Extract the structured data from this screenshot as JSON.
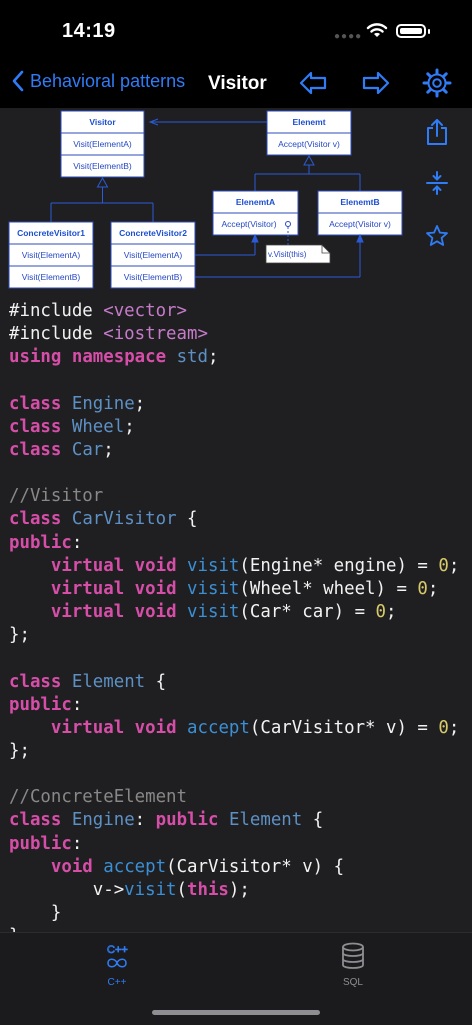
{
  "status": {
    "time": "14:19"
  },
  "nav": {
    "back_label": "Behavioral patterns",
    "title": "Visitor"
  },
  "diagram": {
    "visitor": {
      "title": "Visitor",
      "methods": [
        "Visit(ElementA)",
        "Visit(ElementB)"
      ]
    },
    "element": {
      "title": "Elenemt",
      "methods": [
        "Accept(Visitor v)"
      ]
    },
    "concrete_visitor_1": {
      "title": "ConcreteVisitor1",
      "methods": [
        "Visit(ElementA)",
        "Visit(ElementB)"
      ]
    },
    "concrete_visitor_2": {
      "title": "ConcreteVisitor2",
      "methods": [
        "Visit(ElementA)",
        "Visit(ElementB)"
      ]
    },
    "element_a": {
      "title": "ElenemtA",
      "methods": [
        "Accept(Visitor)"
      ]
    },
    "element_b": {
      "title": "ElenemtB",
      "methods": [
        "Accept(Visitor v)"
      ]
    },
    "note": "v.Visit(this)",
    "colors": {
      "line": "#2b5bd6",
      "box_border": "#2c4db8",
      "title_text": "#1b4fd0",
      "method_text": "#2548c4"
    }
  },
  "code": {
    "lines": [
      [
        [
          "plain",
          "#include "
        ],
        [
          "inc",
          "<vector>"
        ]
      ],
      [
        [
          "plain",
          "#include "
        ],
        [
          "inc",
          "<iostream>"
        ]
      ],
      [
        [
          "kw",
          "using"
        ],
        [
          "plain",
          " "
        ],
        [
          "kw",
          "namespace"
        ],
        [
          "plain",
          " "
        ],
        [
          "ty",
          "std"
        ],
        [
          "plain",
          ";"
        ]
      ],
      [],
      [
        [
          "kw",
          "class"
        ],
        [
          "plain",
          " "
        ],
        [
          "ty",
          "Engine"
        ],
        [
          "plain",
          ";"
        ]
      ],
      [
        [
          "kw",
          "class"
        ],
        [
          "plain",
          " "
        ],
        [
          "ty",
          "Wheel"
        ],
        [
          "plain",
          ";"
        ]
      ],
      [
        [
          "kw",
          "class"
        ],
        [
          "plain",
          " "
        ],
        [
          "ty",
          "Car"
        ],
        [
          "plain",
          ";"
        ]
      ],
      [],
      [
        [
          "cm",
          "//Visitor"
        ]
      ],
      [
        [
          "kw",
          "class"
        ],
        [
          "plain",
          " "
        ],
        [
          "ty",
          "CarVisitor"
        ],
        [
          "plain",
          " {"
        ]
      ],
      [
        [
          "kw",
          "public"
        ],
        [
          "plain",
          ":"
        ]
      ],
      [
        [
          "plain",
          "    "
        ],
        [
          "kw",
          "virtual"
        ],
        [
          "plain",
          " "
        ],
        [
          "kw",
          "void"
        ],
        [
          "plain",
          " "
        ],
        [
          "fn",
          "visit"
        ],
        [
          "plain",
          "(Engine* engine) = "
        ],
        [
          "num",
          "0"
        ],
        [
          "plain",
          ";"
        ]
      ],
      [
        [
          "plain",
          "    "
        ],
        [
          "kw",
          "virtual"
        ],
        [
          "plain",
          " "
        ],
        [
          "kw",
          "void"
        ],
        [
          "plain",
          " "
        ],
        [
          "fn",
          "visit"
        ],
        [
          "plain",
          "(Wheel* wheel) = "
        ],
        [
          "num",
          "0"
        ],
        [
          "plain",
          ";"
        ]
      ],
      [
        [
          "plain",
          "    "
        ],
        [
          "kw",
          "virtual"
        ],
        [
          "plain",
          " "
        ],
        [
          "kw",
          "void"
        ],
        [
          "plain",
          " "
        ],
        [
          "fn",
          "visit"
        ],
        [
          "plain",
          "(Car* car) = "
        ],
        [
          "num",
          "0"
        ],
        [
          "plain",
          ";"
        ]
      ],
      [
        [
          "plain",
          "};"
        ]
      ],
      [],
      [
        [
          "kw",
          "class"
        ],
        [
          "plain",
          " "
        ],
        [
          "ty",
          "Element"
        ],
        [
          "plain",
          " {"
        ]
      ],
      [
        [
          "kw",
          "public"
        ],
        [
          "plain",
          ":"
        ]
      ],
      [
        [
          "plain",
          "    "
        ],
        [
          "kw",
          "virtual"
        ],
        [
          "plain",
          " "
        ],
        [
          "kw",
          "void"
        ],
        [
          "plain",
          " "
        ],
        [
          "fn",
          "accept"
        ],
        [
          "plain",
          "(CarVisitor* v) = "
        ],
        [
          "num",
          "0"
        ],
        [
          "plain",
          ";"
        ]
      ],
      [
        [
          "plain",
          "};"
        ]
      ],
      [],
      [
        [
          "cm",
          "//ConcreteElement"
        ]
      ],
      [
        [
          "kw",
          "class"
        ],
        [
          "plain",
          " "
        ],
        [
          "ty",
          "Engine"
        ],
        [
          "plain",
          ": "
        ],
        [
          "kw",
          "public"
        ],
        [
          "plain",
          " "
        ],
        [
          "ty",
          "Element"
        ],
        [
          "plain",
          " {"
        ]
      ],
      [
        [
          "kw",
          "public"
        ],
        [
          "plain",
          ":"
        ]
      ],
      [
        [
          "plain",
          "    "
        ],
        [
          "kw",
          "void"
        ],
        [
          "plain",
          " "
        ],
        [
          "fn",
          "accept"
        ],
        [
          "plain",
          "(CarVisitor* v) {"
        ]
      ],
      [
        [
          "plain",
          "        v->"
        ],
        [
          "fn",
          "visit"
        ],
        [
          "plain",
          "("
        ],
        [
          "kw",
          "this"
        ],
        [
          "plain",
          ");"
        ]
      ],
      [
        [
          "plain",
          "    }"
        ]
      ],
      [
        [
          "plain",
          "}"
        ]
      ]
    ]
  },
  "tabs": [
    {
      "label": "C++",
      "icon": "cpp-icon",
      "active": true
    },
    {
      "label": "SQL",
      "icon": "database-icon",
      "active": false
    }
  ],
  "colors": {
    "accent": "#2f7cf6",
    "inactive": "#8e8e92",
    "code_bg": "#1f1f21"
  }
}
